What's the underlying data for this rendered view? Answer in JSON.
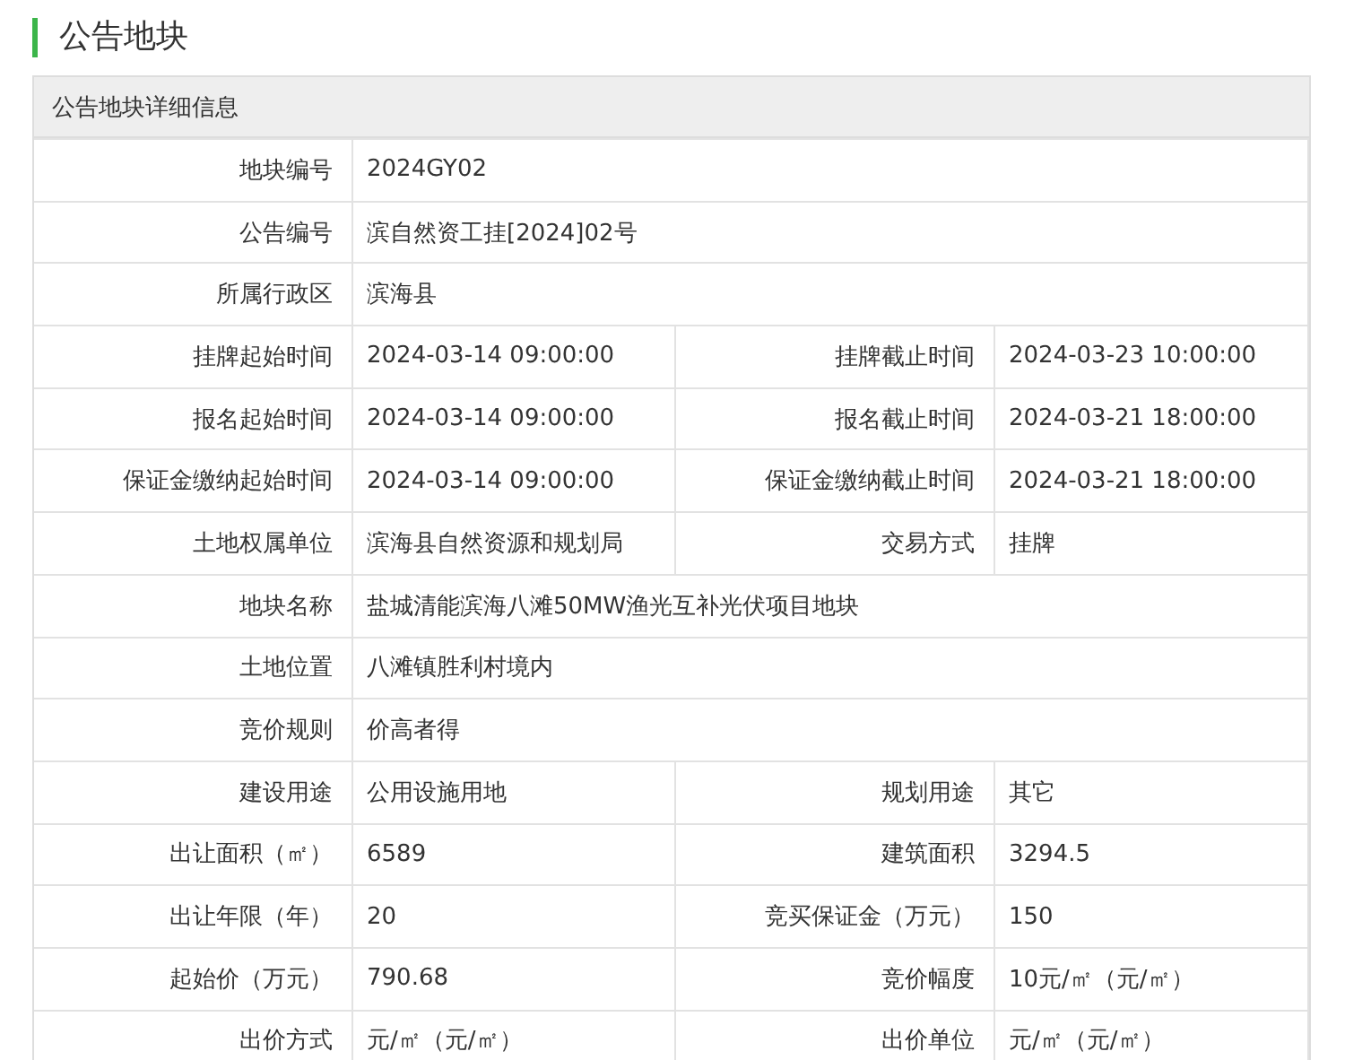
{
  "page_title": "公告地块",
  "panel": {
    "title": "公告地块详细信息",
    "rows": [
      [
        {
          "label": "地块编号",
          "value": "2024GY02"
        }
      ],
      [
        {
          "label": "公告编号",
          "value": "滨自然资工挂[2024]02号"
        }
      ],
      [
        {
          "label": "所属行政区",
          "value": "滨海县"
        }
      ],
      [
        {
          "label": "挂牌起始时间",
          "value": "2024-03-14 09:00:00"
        },
        {
          "label": "挂牌截止时间",
          "value": "2024-03-23 10:00:00"
        }
      ],
      [
        {
          "label": "报名起始时间",
          "value": "2024-03-14 09:00:00"
        },
        {
          "label": "报名截止时间",
          "value": "2024-03-21 18:00:00"
        }
      ],
      [
        {
          "label": "保证金缴纳起始时间",
          "value": "2024-03-14 09:00:00"
        },
        {
          "label": "保证金缴纳截止时间",
          "value": "2024-03-21 18:00:00"
        }
      ],
      [
        {
          "label": "土地权属单位",
          "value": "滨海县自然资源和规划局"
        },
        {
          "label": "交易方式",
          "value": "挂牌"
        }
      ],
      [
        {
          "label": "地块名称",
          "value": "盐城清能滨海八滩50MW渔光互补光伏项目地块"
        }
      ],
      [
        {
          "label": "土地位置",
          "value": "八滩镇胜利村境内"
        }
      ],
      [
        {
          "label": "竞价规则",
          "value": "价高者得"
        }
      ],
      [
        {
          "label": "建设用途",
          "value": "公用设施用地"
        },
        {
          "label": "规划用途",
          "value": "其它"
        }
      ],
      [
        {
          "label": "出让面积（㎡）",
          "value": "6589"
        },
        {
          "label": "建筑面积",
          "value": "3294.5"
        }
      ],
      [
        {
          "label": "出让年限（年）",
          "value": "20"
        },
        {
          "label": "竞买保证金（万元）",
          "value": "150"
        }
      ],
      [
        {
          "label": "起始价（万元）",
          "value": "790.68"
        },
        {
          "label": "竞价幅度",
          "value": "10元/㎡（元/㎡）"
        }
      ],
      [
        {
          "label": "出价方式",
          "value": "元/㎡（元/㎡）"
        },
        {
          "label": "出价单位",
          "value": "元/㎡（元/㎡）"
        }
      ]
    ]
  }
}
